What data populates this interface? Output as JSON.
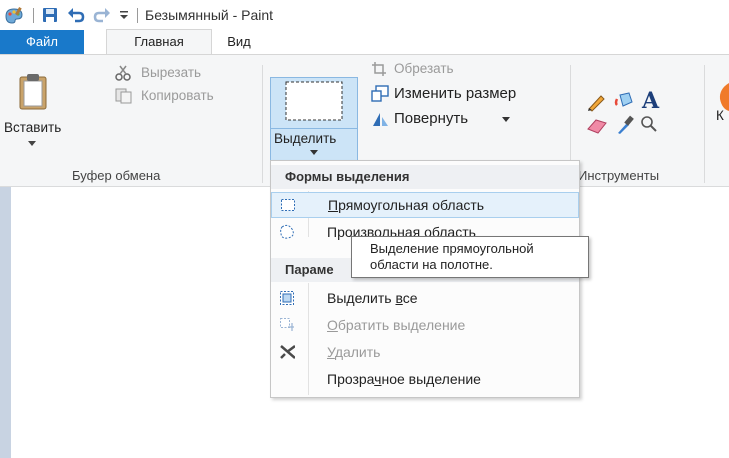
{
  "titlebar": {
    "title": "Безымянный - Paint"
  },
  "tabs": [
    {
      "label": "Файл"
    },
    {
      "label": "Главная"
    },
    {
      "label": "Вид"
    }
  ],
  "clipboard": {
    "paste": "Вставить",
    "cut": "Вырезать",
    "copy": "Копировать",
    "group_label": "Буфер обмена"
  },
  "image": {
    "select": "Выделить",
    "crop": "Обрезать",
    "resize": "Изменить размер",
    "rotate": "Повернуть"
  },
  "tools": {
    "group_label": "Инструменты",
    "text_tool_glyph": "A"
  },
  "partial_next": "К",
  "menu": {
    "section1": "Формы выделения",
    "rect": {
      "pre": "",
      "u": "П",
      "post": "рямоугольная область"
    },
    "free": "Произвольная область",
    "section2": "Параме",
    "select_all": {
      "pre": "Выделить ",
      "u": "в",
      "post": "се"
    },
    "invert": {
      "pre": "",
      "u": "О",
      "post": "братить выделение"
    },
    "delete": {
      "pre": "",
      "u": "У",
      "post": "далить"
    },
    "transparent": {
      "pre": "Прозра",
      "u": "ч",
      "post": "ное выделение"
    }
  },
  "tooltip": {
    "line1": "Выделение прямоугольной",
    "line2": "области на полотне."
  },
  "colors": {
    "file_tab": "#1979ca",
    "hover_bg": "#e5f1fb",
    "hover_border": "#a9cfee"
  }
}
